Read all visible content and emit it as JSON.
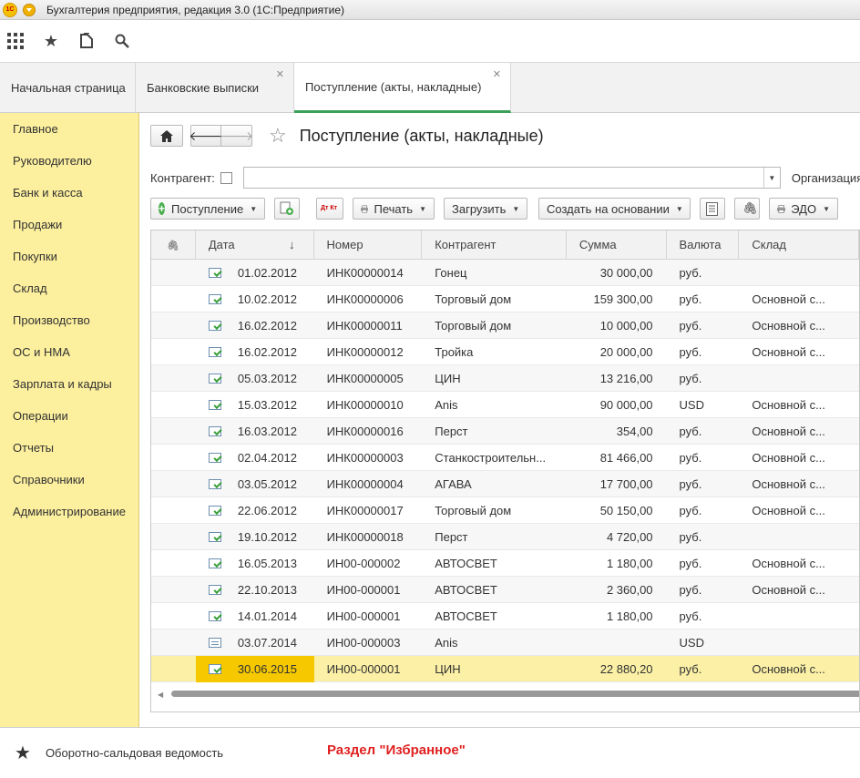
{
  "window": {
    "title": "Бухгалтерия предприятия, редакция 3.0  (1С:Предприятие)"
  },
  "toolbar": {
    "icons": [
      "apps-grid-icon",
      "star-icon",
      "history-icon",
      "search-icon"
    ]
  },
  "tabs": [
    {
      "label": "Начальная страница",
      "closable": false
    },
    {
      "label": "Банковские выписки",
      "closable": true
    },
    {
      "label": "Поступление (акты, накладные)",
      "closable": true,
      "active": true
    }
  ],
  "sidebar": {
    "items": [
      "Главное",
      "Руководителю",
      "Банк и касса",
      "Продажи",
      "Покупки",
      "Склад",
      "Производство",
      "ОС и НМА",
      "Зарплата и кадры",
      "Операции",
      "Отчеты",
      "Справочники",
      "Администрирование"
    ]
  },
  "page": {
    "title": "Поступление (акты, накладные)"
  },
  "filters": {
    "kontragent_label": "Контрагент:",
    "kontragent_value": "",
    "organization_label": "Организация:"
  },
  "commands": {
    "receipt": "Поступление",
    "print": "Печать",
    "load": "Загрузить",
    "create_based": "Создать на основании",
    "edo": "ЭДО",
    "dtkt": "Дт Кт"
  },
  "table": {
    "columns": {
      "attach": "",
      "date": "Дата",
      "number": "Номер",
      "counterparty": "Контрагент",
      "sum": "Сумма",
      "currency": "Валюта",
      "warehouse": "Склад"
    },
    "sort_indicator": "↓",
    "rows": [
      {
        "status": "posted",
        "date": "01.02.2012",
        "number": "ИНК00000014",
        "counterparty": "Гонец",
        "sum": "30 000,00",
        "currency": "руб.",
        "warehouse": ""
      },
      {
        "status": "posted",
        "date": "10.02.2012",
        "number": "ИНК00000006",
        "counterparty": "Торговый дом",
        "sum": "159 300,00",
        "currency": "руб.",
        "warehouse": "Основной с..."
      },
      {
        "status": "posted",
        "date": "16.02.2012",
        "number": "ИНК00000011",
        "counterparty": "Торговый дом",
        "sum": "10 000,00",
        "currency": "руб.",
        "warehouse": "Основной с..."
      },
      {
        "status": "posted",
        "date": "16.02.2012",
        "number": "ИНК00000012",
        "counterparty": "Тройка",
        "sum": "20 000,00",
        "currency": "руб.",
        "warehouse": "Основной с..."
      },
      {
        "status": "posted",
        "date": "05.03.2012",
        "number": "ИНК00000005",
        "counterparty": "ЦИН",
        "sum": "13 216,00",
        "currency": "руб.",
        "warehouse": ""
      },
      {
        "status": "posted",
        "date": "15.03.2012",
        "number": "ИНК00000010",
        "counterparty": "Anis",
        "sum": "90 000,00",
        "currency": "USD",
        "warehouse": "Основной с..."
      },
      {
        "status": "posted",
        "date": "16.03.2012",
        "number": "ИНК00000016",
        "counterparty": "Перст",
        "sum": "354,00",
        "currency": "руб.",
        "warehouse": "Основной с..."
      },
      {
        "status": "posted",
        "date": "02.04.2012",
        "number": "ИНК00000003",
        "counterparty": "Станкостроительн...",
        "sum": "81 466,00",
        "currency": "руб.",
        "warehouse": "Основной с..."
      },
      {
        "status": "posted",
        "date": "03.05.2012",
        "number": "ИНК00000004",
        "counterparty": "АГАВА",
        "sum": "17 700,00",
        "currency": "руб.",
        "warehouse": "Основной с..."
      },
      {
        "status": "posted",
        "date": "22.06.2012",
        "number": "ИНК00000017",
        "counterparty": "Торговый дом",
        "sum": "50 150,00",
        "currency": "руб.",
        "warehouse": "Основной с..."
      },
      {
        "status": "posted",
        "date": "19.10.2012",
        "number": "ИНК00000018",
        "counterparty": "Перст",
        "sum": "4 720,00",
        "currency": "руб.",
        "warehouse": ""
      },
      {
        "status": "posted",
        "date": "16.05.2013",
        "number": "ИН00-000002",
        "counterparty": "АВТОСВЕТ",
        "sum": "1 180,00",
        "currency": "руб.",
        "warehouse": "Основной с..."
      },
      {
        "status": "posted",
        "date": "22.10.2013",
        "number": "ИН00-000001",
        "counterparty": "АВТОСВЕТ",
        "sum": "2 360,00",
        "currency": "руб.",
        "warehouse": "Основной с..."
      },
      {
        "status": "posted",
        "date": "14.01.2014",
        "number": "ИН00-000001",
        "counterparty": "АВТОСВЕТ",
        "sum": "1 180,00",
        "currency": "руб.",
        "warehouse": ""
      },
      {
        "status": "draft",
        "date": "03.07.2014",
        "number": "ИН00-000003",
        "counterparty": "Anis",
        "sum": "",
        "currency": "USD",
        "warehouse": ""
      },
      {
        "status": "posted",
        "date": "30.06.2015",
        "number": "ИН00-000001",
        "counterparty": "ЦИН",
        "sum": "22 880,20",
        "currency": "руб.",
        "warehouse": "Основной с...",
        "selected": true
      }
    ]
  },
  "favorites": {
    "item": "Оборотно-сальдовая ведомость",
    "note": "Раздел \"Избранное\""
  },
  "colors": {
    "sidebar": "#fcef9e",
    "selected_row": "#fbf0a6",
    "current_cell": "#f5c800",
    "active_tab_line": "#3ca05a",
    "note": "#e02020"
  }
}
